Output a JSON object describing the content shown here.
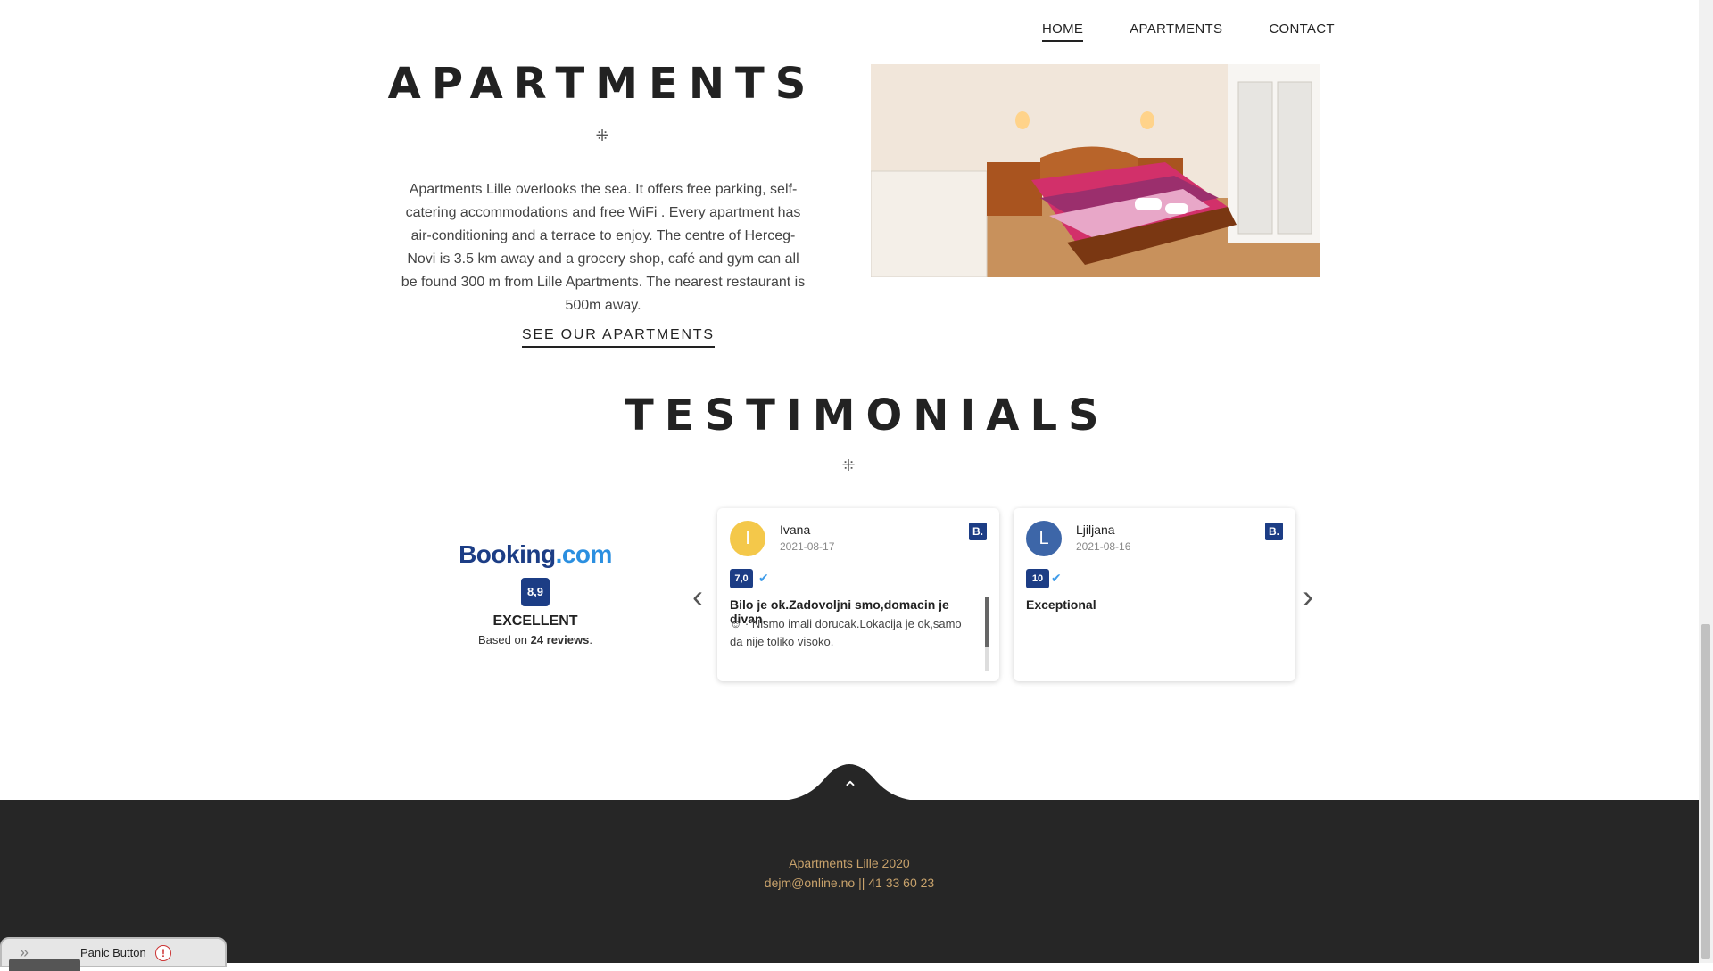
{
  "nav": {
    "items": [
      {
        "label": "HOME",
        "active": true
      },
      {
        "label": "APARTMENTS",
        "active": false
      },
      {
        "label": "CONTACT",
        "active": false
      }
    ]
  },
  "apartments": {
    "title": "APARTMENTS",
    "ornament": "⁜",
    "description": "Apartments Lille overlooks the sea. It offers free parking, self-catering accommodations and free WiFi . Every apartment has air-conditioning and a terrace to enjoy. The centre of Herceg-Novi is 3.5 km away and a grocery shop,  café and gym can all be found 300 m from Lille Apartments. The nearest restaurant is 500m away.",
    "cta": "SEE OUR APARTMENTS"
  },
  "testimonials": {
    "title": "TESTIMONIALS",
    "ornament": "⁜",
    "summary": {
      "logo_part1": "Booking",
      "logo_part2": ".com",
      "score": "8,9",
      "rating_text": "EXCELLENT",
      "based_prefix": "Based on ",
      "based_count": "24 reviews",
      "based_suffix": "."
    },
    "prev_icon": "‹",
    "next_icon": "›",
    "reviews": [
      {
        "initial": "I",
        "avatar_color": "#f4c84a",
        "name": "Ivana",
        "date": "2021-08-17",
        "source_icon": "B.",
        "score": "7,0",
        "headline": "Bilo je ok.Zadovoljni smo,domacin je divan.",
        "body": "☺ · Nismo imali dorucak.Lokacija je ok,samo da nije toliko visoko."
      },
      {
        "initial": "L",
        "avatar_color": "#3d66a8",
        "name": "Ljiljana",
        "date": "2021-08-16",
        "source_icon": "B.",
        "score": "10",
        "headline": "Exceptional",
        "body": ""
      }
    ]
  },
  "footer": {
    "up_icon": "⌃",
    "line1": "Apartments Lille 2020",
    "line2": "dejm@online.no || 41 33 60 23"
  },
  "panic": {
    "label": "Panic Button",
    "alert_icon": "!"
  }
}
